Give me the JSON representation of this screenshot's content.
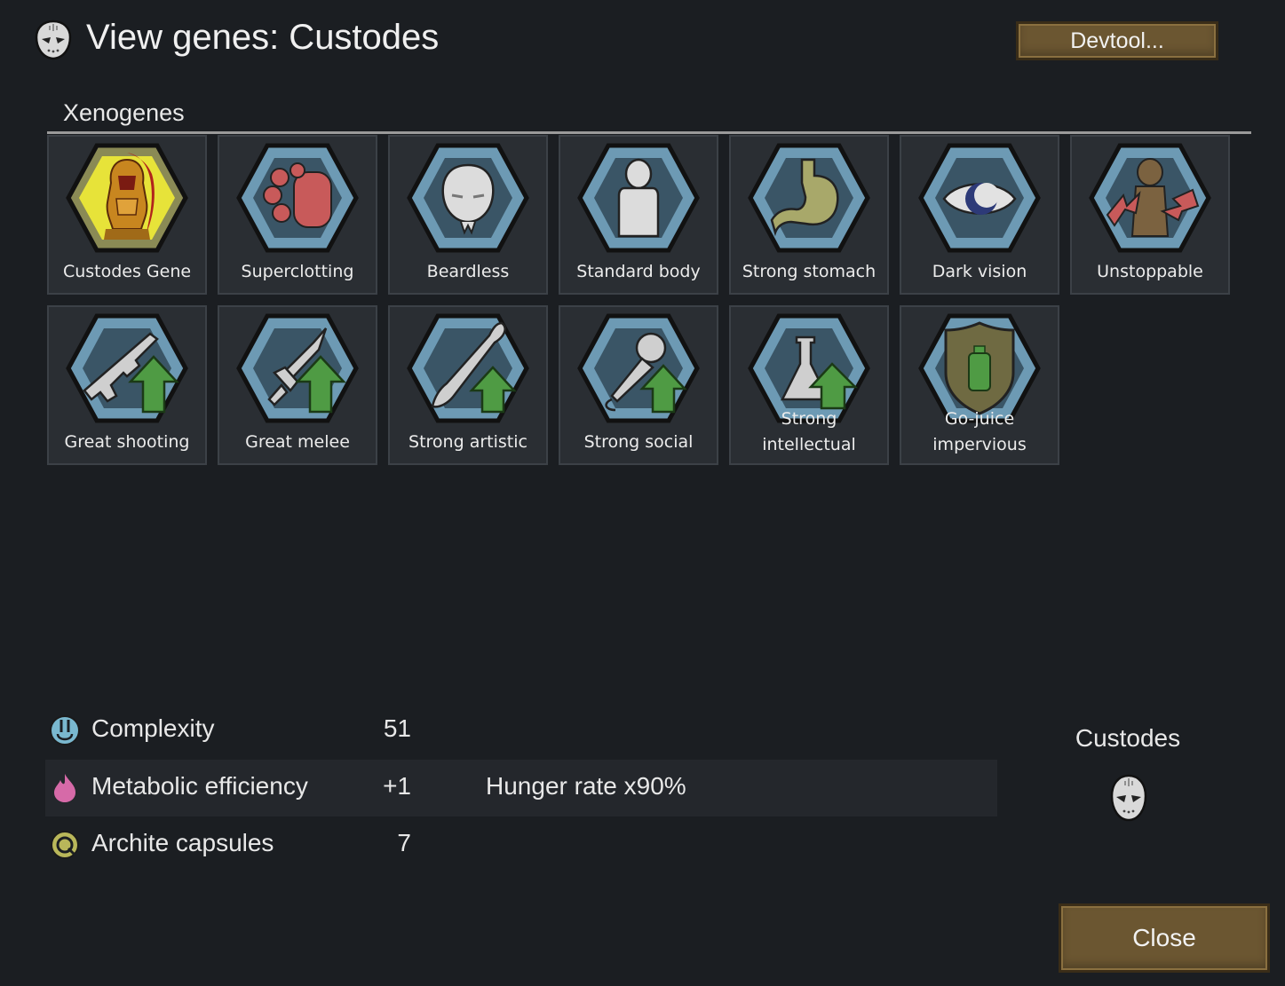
{
  "window": {
    "title": "View genes: Custodes",
    "title_icon": "skull-mask-icon",
    "devtool_label": "Devtool...",
    "close_label": "Close"
  },
  "section": {
    "label": "Xenogenes"
  },
  "genes": [
    {
      "label": "Custodes Gene",
      "icon": "custodes-helmet-icon"
    },
    {
      "label": "Superclotting",
      "icon": "blood-cells-icon"
    },
    {
      "label": "Beardless",
      "icon": "beardless-face-icon"
    },
    {
      "label": "Standard body",
      "icon": "body-silhouette-icon"
    },
    {
      "label": "Strong stomach",
      "icon": "stomach-icon"
    },
    {
      "label": "Dark vision",
      "icon": "eye-icon"
    },
    {
      "label": "Unstoppable",
      "icon": "unstoppable-body-icon"
    },
    {
      "label": "Great shooting",
      "icon": "rifle-up-arrow-icon"
    },
    {
      "label": "Great melee",
      "icon": "sword-up-arrow-icon"
    },
    {
      "label": "Strong artistic",
      "icon": "brush-up-arrow-icon"
    },
    {
      "label": "Strong social",
      "icon": "microphone-up-arrow-icon"
    },
    {
      "label": "Strong\nintellectual",
      "icon": "flask-up-arrow-icon"
    },
    {
      "label": "Go-juice\nimpervious",
      "icon": "shield-bottle-icon"
    }
  ],
  "stats": [
    {
      "name": "Complexity",
      "value": "51",
      "effect": "",
      "icon": "complexity-icon"
    },
    {
      "name": "Metabolic efficiency",
      "value": "+1",
      "effect": "Hunger rate x90%",
      "icon": "metabolism-flame-icon"
    },
    {
      "name": "Archite capsules",
      "value": "7",
      "effect": "",
      "icon": "archite-capsule-icon"
    }
  ],
  "xenotype": {
    "name": "Custodes",
    "icon": "skull-mask-icon"
  },
  "colors": {
    "background": "#1b1e22",
    "button": "#6b5631",
    "hex_blue": "#6d9ab4",
    "green_arrow": "#4f9b44"
  }
}
